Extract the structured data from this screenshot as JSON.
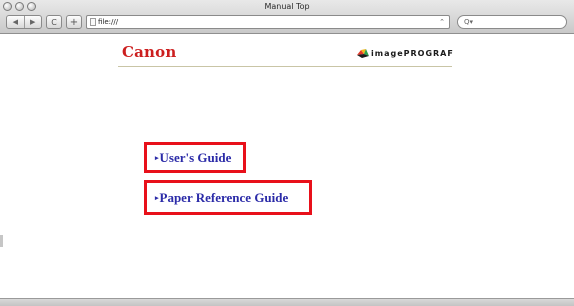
{
  "window": {
    "title": "Manual Top"
  },
  "toolbar": {
    "back_icon": "◀",
    "forward_icon": "▶",
    "reload_icon": "C",
    "add_bookmark_icon": "+",
    "url": "file:///",
    "url_dropdown_icon": "⌃",
    "search_icon": "Q▾"
  },
  "page": {
    "canon_logo": "Canon",
    "imageprograf_logo": "imagePROGRAF",
    "links": [
      {
        "bullet": "▸",
        "label": "User's Guide"
      },
      {
        "bullet": "▸",
        "label": "Paper Reference Guide"
      }
    ]
  },
  "colors": {
    "canon_red": "#cc1f1f",
    "link_blue": "#2b2ba8",
    "highlight_red": "#e8101a"
  }
}
